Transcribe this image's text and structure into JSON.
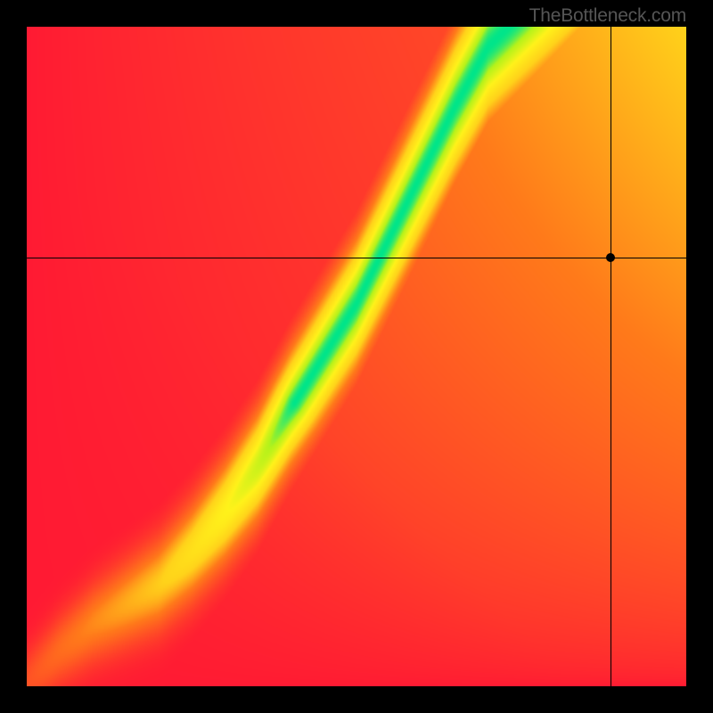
{
  "watermark": "TheBottleneck.com",
  "chart_data": {
    "type": "heatmap",
    "title": "",
    "xlabel": "",
    "ylabel": "",
    "xlim": [
      0,
      1
    ],
    "ylim": [
      0,
      1
    ],
    "marker": {
      "x": 0.885,
      "y": 0.65
    },
    "crosshair": {
      "x": 0.885,
      "y": 0.65
    },
    "ridge_path": [
      {
        "x": 0.0,
        "y": 0.0
      },
      {
        "x": 0.05,
        "y": 0.05
      },
      {
        "x": 0.1,
        "y": 0.09
      },
      {
        "x": 0.15,
        "y": 0.12
      },
      {
        "x": 0.2,
        "y": 0.15
      },
      {
        "x": 0.25,
        "y": 0.2
      },
      {
        "x": 0.3,
        "y": 0.26
      },
      {
        "x": 0.35,
        "y": 0.33
      },
      {
        "x": 0.4,
        "y": 0.42
      },
      {
        "x": 0.45,
        "y": 0.5
      },
      {
        "x": 0.5,
        "y": 0.58
      },
      {
        "x": 0.55,
        "y": 0.68
      },
      {
        "x": 0.6,
        "y": 0.78
      },
      {
        "x": 0.65,
        "y": 0.88
      },
      {
        "x": 0.7,
        "y": 0.97
      },
      {
        "x": 0.73,
        "y": 1.0
      }
    ],
    "color_stops": [
      {
        "offset": 0.0,
        "color": "#ff1a33"
      },
      {
        "offset": 0.35,
        "color": "#ff7a1a"
      },
      {
        "offset": 0.55,
        "color": "#ffd21a"
      },
      {
        "offset": 0.75,
        "color": "#fff21a"
      },
      {
        "offset": 0.9,
        "color": "#b6f21a"
      },
      {
        "offset": 1.0,
        "color": "#00e58a"
      }
    ],
    "field_description": "2D scalar field; value peaks (green) along a curved ridge from lower-left to upper-center, falls through yellow/orange to red away from ridge. Upper-right off-ridge region is yellow; lower-right and left regions are red."
  }
}
